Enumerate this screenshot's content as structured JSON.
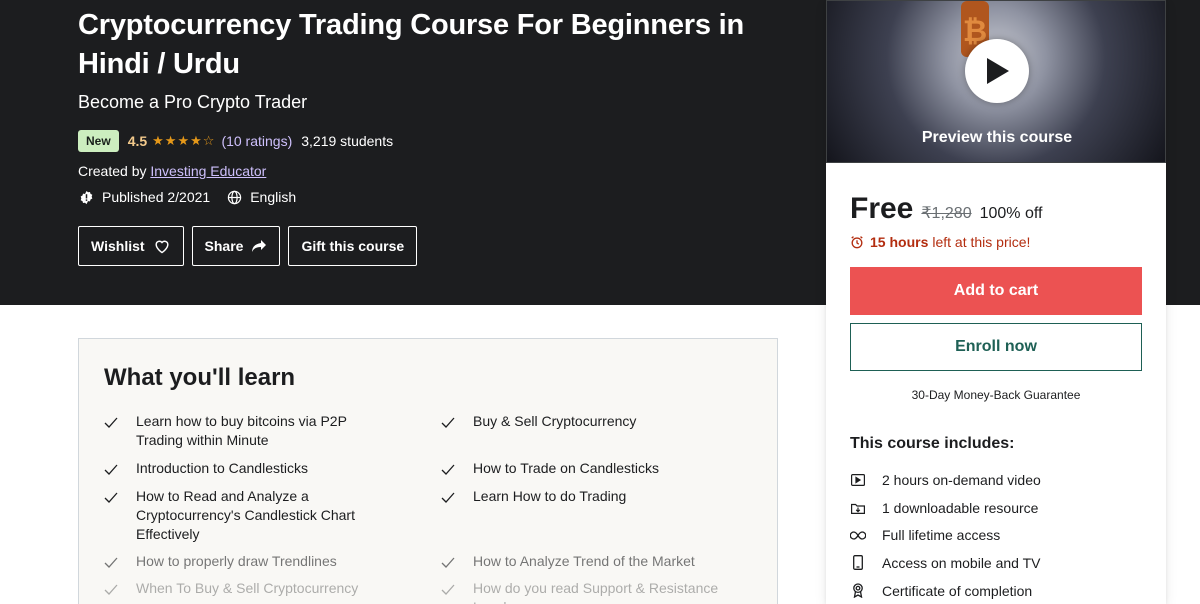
{
  "course": {
    "title": "Cryptocurrency Trading Course For Beginners in Hindi / Urdu",
    "subtitle": "Become a Pro Crypto Trader",
    "badge": "New",
    "rating": "4.5",
    "stars": "★★★★☆",
    "rating_count": "(10 ratings)",
    "students": "3,219 students",
    "created_prefix": "Created by",
    "instructor": "Investing Educator",
    "published": "Published 2/2021",
    "language": "English",
    "buttons": {
      "wishlist": "Wishlist",
      "share": "Share",
      "gift": "Gift this course"
    }
  },
  "sidebar": {
    "preview_label": "Preview this course",
    "price": "Free",
    "original_price": "₹1,280",
    "discount": "100% off",
    "timer_hours": "15 hours",
    "timer_rest": "left at this price!",
    "add_to_cart": "Add to cart",
    "enroll": "Enroll now",
    "guarantee": "30-Day Money-Back Guarantee",
    "includes_title": "This course includes:",
    "includes": [
      {
        "icon": "video-icon",
        "label": "2 hours on-demand video"
      },
      {
        "icon": "download-icon",
        "label": "1 downloadable resource"
      },
      {
        "icon": "infinity-icon",
        "label": "Full lifetime access"
      },
      {
        "icon": "mobile-icon",
        "label": "Access on mobile and TV"
      },
      {
        "icon": "certificate-icon",
        "label": "Certificate of completion"
      }
    ]
  },
  "learn": {
    "title": "What you'll learn",
    "left": [
      "Learn how to buy bitcoins via P2P Trading within Minute",
      "Introduction to Candlesticks",
      "How to Read and Analyze a Cryptocurrency's Candlestick Chart Effectively",
      "How to properly draw Trendlines",
      "When To Buy & Sell Cryptocurrency"
    ],
    "right": [
      "Buy & Sell Cryptocurrency",
      "How to Trade on Candlesticks",
      "Learn How to do Trading",
      "How to Analyze Trend of the Market",
      "How do you read Support & Resistance Levels"
    ]
  },
  "colors": {
    "hero_bg": "#1c1d1f",
    "cart": "#ec5252",
    "enroll": "#1e6055",
    "badge_bg": "#cceebf",
    "star": "#e59819",
    "timer": "#b32d0f"
  }
}
